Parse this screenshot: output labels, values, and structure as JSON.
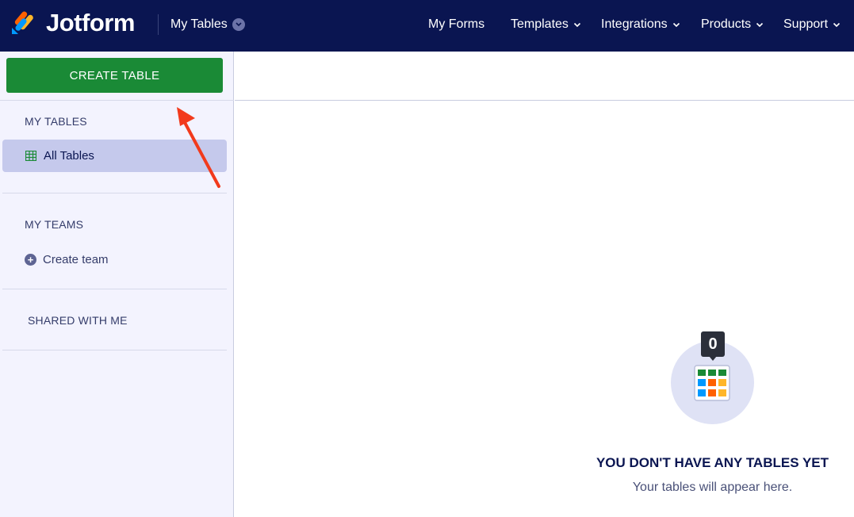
{
  "app": {
    "brand": "Jotform",
    "section_dropdown": "My Tables"
  },
  "nav": {
    "items": [
      {
        "label": "My Forms",
        "has_dropdown": false
      },
      {
        "label": "Templates",
        "has_dropdown": true
      },
      {
        "label": "Integrations",
        "has_dropdown": true
      },
      {
        "label": "Products",
        "has_dropdown": true
      },
      {
        "label": "Support",
        "has_dropdown": true
      }
    ]
  },
  "sidebar": {
    "create_button": "CREATE TABLE",
    "my_tables_title": "MY TABLES",
    "all_tables_label": "All Tables",
    "my_teams_title": "MY TEAMS",
    "create_team_label": "Create team",
    "shared_title": "SHARED WITH ME"
  },
  "empty_state": {
    "count": "0",
    "title": "YOU DON'T HAVE ANY TABLES YET",
    "subtitle": "Your tables will appear here."
  },
  "colors": {
    "topbar": "#0a1551",
    "create_button": "#1a8a36",
    "sidebar": "#f3f3fe",
    "selected_item": "#c5c9ec",
    "annotation_arrow": "#f23a1c"
  }
}
